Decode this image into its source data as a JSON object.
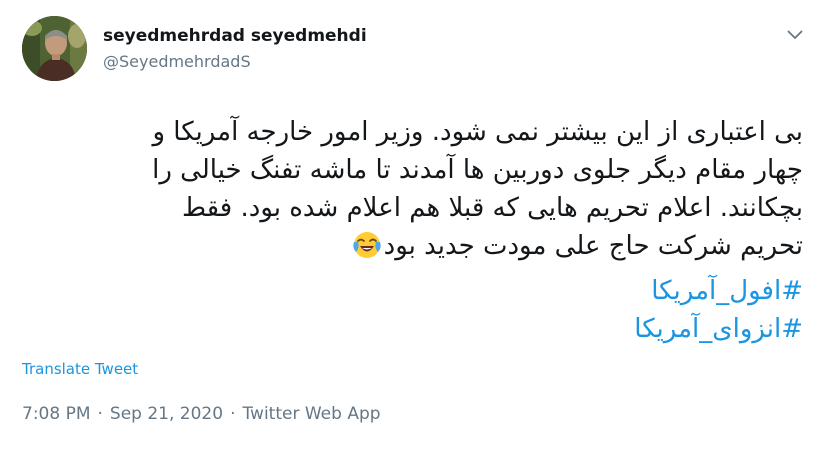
{
  "author": {
    "display_name": "seyedmehrdad seyedmehdi",
    "handle": "@SeyedmehrdadS"
  },
  "icons": {
    "avatar": "profile-photo",
    "menu": "chevron-down-icon",
    "emoji": "face-with-tears-of-joy"
  },
  "tweet": {
    "lines": [
      "بی اعتباری از این بیشتر نمی شود. وزیر امور خارجه آمریکا و",
      "چهار مقام دیگر جلوی دوربین ها آمدند تا ماشه تفنگ خیالی را",
      "بچکانند. اعلام تحریم هایی که قبلا هم اعلام شده بود. فقط",
      "تحریم شرکت حاج علی مودت جدید بود"
    ],
    "hashtags": [
      "#افول_آمریکا",
      "#انزوای_آمریکا"
    ]
  },
  "translate_label": "Translate Tweet",
  "timestamp": {
    "time": "7:08 PM",
    "date": "Sep 21, 2020",
    "source": "Twitter Web App",
    "separator": "·"
  },
  "colors": {
    "link": "#1b95e0",
    "text": "#14171a",
    "muted": "#657786"
  }
}
